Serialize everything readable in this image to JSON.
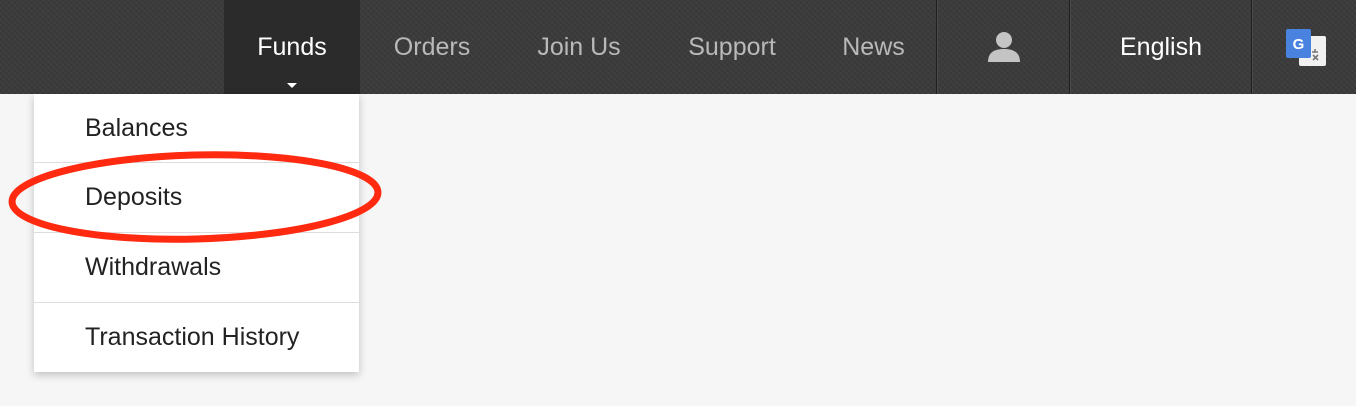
{
  "nav": {
    "items": [
      {
        "label": "Funds",
        "active": true
      },
      {
        "label": "Orders"
      },
      {
        "label": "Join Us"
      },
      {
        "label": "Support"
      },
      {
        "label": "News"
      }
    ],
    "user_icon": "user-icon",
    "language": "English",
    "translate_icon": "google-translate-icon"
  },
  "dropdown": {
    "items": [
      {
        "label": "Balances"
      },
      {
        "label": "Deposits",
        "highlighted": true
      },
      {
        "label": "Withdrawals"
      },
      {
        "label": "Transaction History"
      }
    ]
  },
  "colors": {
    "navbar_bg": "#3b3b3b",
    "active_bg": "#2b2b2b",
    "nav_text": "#b9b9b9",
    "highlight": "#ff2a10"
  }
}
